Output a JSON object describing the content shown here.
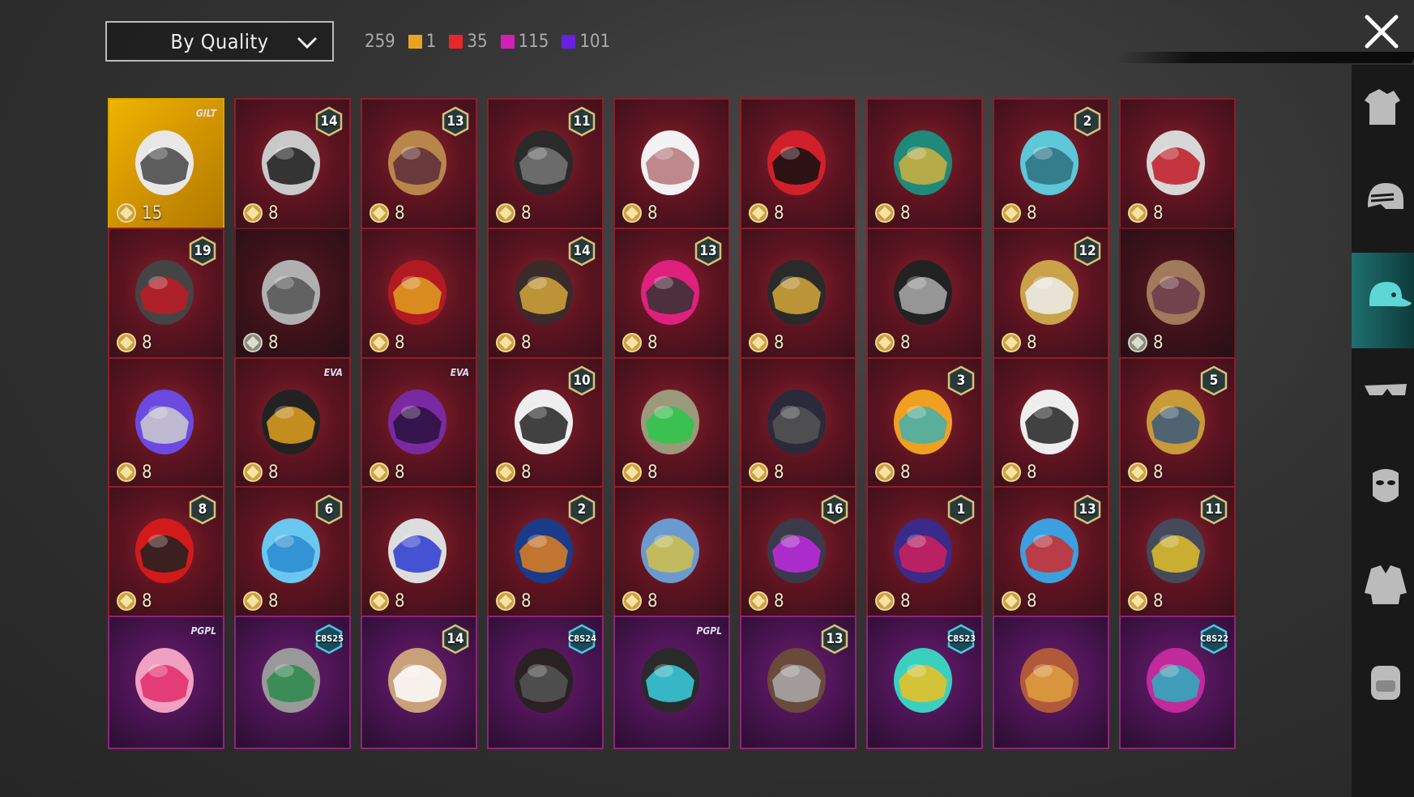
{
  "toolbar": {
    "sort_label": "By Quality",
    "total_count": "259",
    "quality_counts": [
      {
        "color": "#e8a323",
        "count": "1"
      },
      {
        "color": "#e8262b",
        "count": "35"
      },
      {
        "color": "#d11fb7",
        "count": "115"
      },
      {
        "color": "#6a20e0",
        "count": "101"
      }
    ]
  },
  "rows": [
    [
      {
        "quality": "gold",
        "badge": "",
        "tag": "GILT",
        "cost": "15",
        "icon": "winged-helmet-icon",
        "coin": "gold"
      },
      {
        "quality": "red",
        "badge": "14",
        "tag": "",
        "cost": "8",
        "icon": "cat-mask-hood-icon",
        "coin": "gold"
      },
      {
        "quality": "red",
        "badge": "13",
        "tag": "",
        "cost": "8",
        "icon": "straw-hat-icon",
        "coin": "gold"
      },
      {
        "quality": "red",
        "badge": "11",
        "tag": "",
        "cost": "8",
        "icon": "dark-mask-icon",
        "coin": "gold"
      },
      {
        "quality": "red",
        "badge": "",
        "tag": "",
        "cost": "8",
        "icon": "cowboy-hat-icon",
        "coin": "gold"
      },
      {
        "quality": "red",
        "badge": "",
        "tag": "",
        "cost": "8",
        "icon": "red-helmet-icon",
        "coin": "gold"
      },
      {
        "quality": "red",
        "badge": "",
        "tag": "",
        "cost": "8",
        "icon": "dragon-helmet-icon",
        "coin": "gold"
      },
      {
        "quality": "red",
        "badge": "2",
        "tag": "",
        "cost": "8",
        "icon": "bucket-hat-icon",
        "coin": "gold"
      },
      {
        "quality": "red",
        "badge": "",
        "tag": "",
        "cost": "8",
        "icon": "oni-mask-icon",
        "coin": "gold"
      }
    ],
    [
      {
        "quality": "red",
        "badge": "19",
        "tag": "",
        "cost": "8",
        "icon": "knight-helmet-icon",
        "coin": "gold"
      },
      {
        "quality": "dim",
        "badge": "",
        "tag": "",
        "cost": "8",
        "icon": "gray-wig-icon",
        "coin": "silver"
      },
      {
        "quality": "red",
        "badge": "",
        "tag": "",
        "cost": "8",
        "icon": "red-visor-helmet-icon",
        "coin": "gold"
      },
      {
        "quality": "red",
        "badge": "14",
        "tag": "",
        "cost": "8",
        "icon": "samurai-hood-icon",
        "coin": "gold"
      },
      {
        "quality": "red",
        "badge": "13",
        "tag": "",
        "cost": "8",
        "icon": "pink-dreads-mask-icon",
        "coin": "gold"
      },
      {
        "quality": "red",
        "badge": "",
        "tag": "",
        "cost": "8",
        "icon": "horned-hood-icon",
        "coin": "gold"
      },
      {
        "quality": "red",
        "badge": "",
        "tag": "",
        "cost": "8",
        "icon": "ninja-hood-icon",
        "coin": "gold"
      },
      {
        "quality": "red",
        "badge": "12",
        "tag": "",
        "cost": "8",
        "icon": "winged-golden-helmet-icon",
        "coin": "gold"
      },
      {
        "quality": "dim",
        "badge": "",
        "tag": "",
        "cost": "8",
        "icon": "long-hair-icon",
        "coin": "silver"
      }
    ],
    [
      {
        "quality": "red",
        "badge": "",
        "tag": "",
        "cost": "8",
        "icon": "purple-twintails-icon",
        "coin": "gold"
      },
      {
        "quality": "red",
        "badge": "",
        "tag": "EVA",
        "cost": "8",
        "icon": "pilot-hood-icon",
        "coin": "gold"
      },
      {
        "quality": "red",
        "badge": "",
        "tag": "EVA",
        "cost": "8",
        "icon": "purple-helmet-icon",
        "coin": "gold"
      },
      {
        "quality": "red",
        "badge": "10",
        "tag": "",
        "cost": "8",
        "icon": "chef-hat-icon",
        "coin": "gold"
      },
      {
        "quality": "red",
        "badge": "",
        "tag": "",
        "cost": "8",
        "icon": "green-crest-mask-icon",
        "coin": "gold"
      },
      {
        "quality": "red",
        "badge": "",
        "tag": "",
        "cost": "8",
        "icon": "bat-helmet-icon",
        "coin": "gold"
      },
      {
        "quality": "red",
        "badge": "3",
        "tag": "",
        "cost": "8",
        "icon": "fries-hat-icon",
        "coin": "gold"
      },
      {
        "quality": "red",
        "badge": "",
        "tag": "",
        "cost": "8",
        "icon": "white-mask-icon",
        "coin": "gold"
      },
      {
        "quality": "red",
        "badge": "5",
        "tag": "",
        "cost": "8",
        "icon": "gold-armor-helmet-icon",
        "coin": "gold"
      }
    ],
    [
      {
        "quality": "red",
        "badge": "8",
        "tag": "",
        "cost": "8",
        "icon": "red-beret-icon",
        "coin": "gold"
      },
      {
        "quality": "red",
        "badge": "6",
        "tag": "",
        "cost": "8",
        "icon": "ice-crown-icon",
        "coin": "gold"
      },
      {
        "quality": "red",
        "badge": "",
        "tag": "",
        "cost": "8",
        "icon": "silver-crest-helmet-icon",
        "coin": "gold"
      },
      {
        "quality": "red",
        "badge": "2",
        "tag": "",
        "cost": "8",
        "icon": "spiked-blue-helmet-icon",
        "coin": "gold"
      },
      {
        "quality": "red",
        "badge": "",
        "tag": "",
        "cost": "8",
        "icon": "crystal-helmet-icon",
        "coin": "gold"
      },
      {
        "quality": "red",
        "badge": "16",
        "tag": "",
        "cost": "8",
        "icon": "neon-visor-helmet-icon",
        "coin": "gold"
      },
      {
        "quality": "red",
        "badge": "1",
        "tag": "",
        "cost": "8",
        "icon": "purple-orb-helmet-icon",
        "coin": "gold"
      },
      {
        "quality": "red",
        "badge": "13",
        "tag": "",
        "cost": "8",
        "icon": "blue-mecha-helmet-icon",
        "coin": "gold"
      },
      {
        "quality": "red",
        "badge": "11",
        "tag": "",
        "cost": "8",
        "icon": "dark-mecha-helmet-icon",
        "coin": "gold"
      }
    ],
    [
      {
        "quality": "purple",
        "badge": "",
        "tag": "PGPL",
        "cost": "",
        "icon": "bow-headband-icon",
        "coin": ""
      },
      {
        "quality": "purple",
        "badge": "C8S25",
        "tag": "",
        "cost": "",
        "icon": "gray-bun-hair-icon",
        "coin": ""
      },
      {
        "quality": "purple",
        "badge": "14",
        "tag": "",
        "cost": "",
        "icon": "blonde-flower-hair-icon",
        "coin": ""
      },
      {
        "quality": "purple",
        "badge": "C8S24",
        "tag": "",
        "cost": "",
        "icon": "dark-bob-hair-icon",
        "coin": ""
      },
      {
        "quality": "purple",
        "badge": "",
        "tag": "PGPL",
        "cost": "",
        "icon": "dark-messy-hair-icon",
        "coin": ""
      },
      {
        "quality": "purple",
        "badge": "13",
        "tag": "",
        "cost": "",
        "icon": "goggles-cap-icon",
        "coin": ""
      },
      {
        "quality": "purple",
        "badge": "C8S23",
        "tag": "",
        "cost": "",
        "icon": "cat-headphones-icon",
        "coin": ""
      },
      {
        "quality": "purple",
        "badge": "",
        "tag": "",
        "cost": "",
        "icon": "fox-ear-hair-icon",
        "coin": ""
      },
      {
        "quality": "purple",
        "badge": "C8S22",
        "tag": "",
        "cost": "",
        "icon": "pink-teal-hair-icon",
        "coin": ""
      }
    ]
  ],
  "sidebar": [
    {
      "icon": "outfit-icon",
      "active": false
    },
    {
      "icon": "helmet-icon",
      "active": false
    },
    {
      "icon": "cap-icon",
      "active": true
    },
    {
      "icon": "glasses-icon",
      "active": false
    },
    {
      "icon": "mask-icon",
      "active": false
    },
    {
      "icon": "jacket-icon",
      "active": false
    },
    {
      "icon": "backpack-icon",
      "active": false
    }
  ]
}
